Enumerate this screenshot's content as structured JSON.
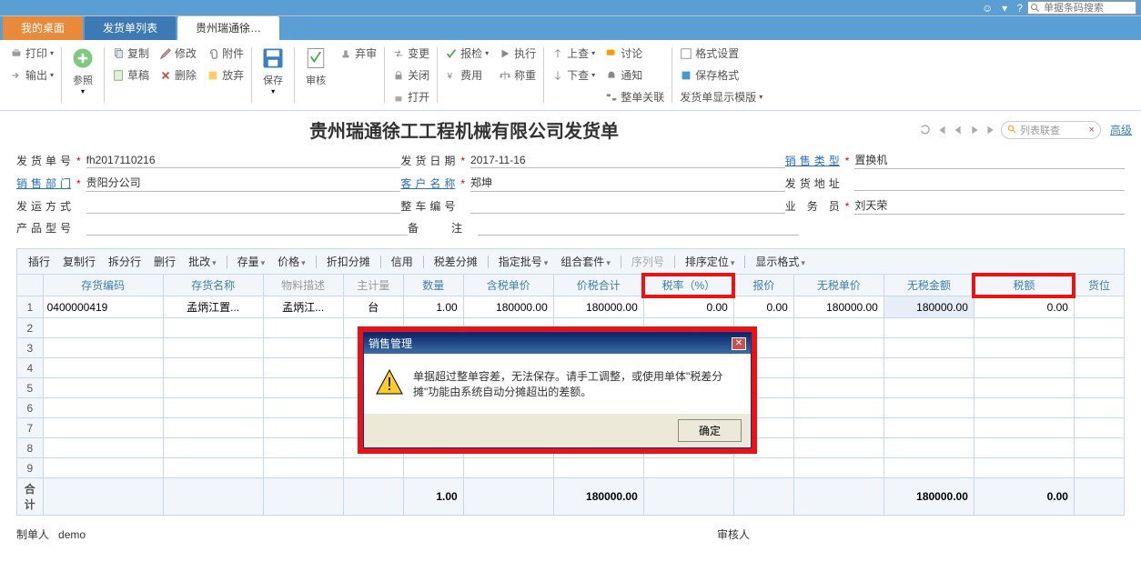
{
  "topbar": {
    "search_placeholder": "单据条码搜索"
  },
  "tabs": [
    {
      "label": "我的桌面",
      "type": "orange"
    },
    {
      "label": "发货单列表",
      "type": "blue"
    },
    {
      "label": "贵州瑞通徐…",
      "type": "active"
    }
  ],
  "toolbar": {
    "print": "打印",
    "output": "输出",
    "ref": "参照",
    "copy": "复制",
    "draft": "草稿",
    "modify": "修改",
    "delete": "删除",
    "attach": "附件",
    "giveup": "放弃",
    "save": "保存",
    "audit": "审核",
    "sendaudit": "弃审",
    "change": "变更",
    "close": "关闭",
    "open": "打开",
    "recheck": "报检",
    "fee": "费用",
    "exec": "执行",
    "weigh": "称重",
    "upcheck": "上查",
    "downcheck": "下查",
    "discuss": "讨论",
    "notify": "通知",
    "wholeclose": "整单关联",
    "fmtset": "格式设置",
    "savefmt": "保存格式",
    "display": "发货单显示模版"
  },
  "title": "贵州瑞通徐工工程机械有限公司发货单",
  "title_nav": {
    "search": "列表联查",
    "advanced": "高级"
  },
  "form": {
    "r1": {
      "l1": "发货单号",
      "v1": "fh2017110216",
      "l2": "发货日期",
      "v2": "2017-11-16",
      "l3": "销售类型",
      "v3": "置换机"
    },
    "r2": {
      "l1": "销售部门",
      "v1": "贵阳分公司",
      "l2": "客户名称",
      "v2": "郑坤",
      "l3": "发货地址",
      "v3": ""
    },
    "r3": {
      "l1": "发运方式",
      "v1": "",
      "l2": "整车编号",
      "v2": "",
      "l3": "业 务 员",
      "v3": "刘天荣"
    },
    "r4": {
      "l1": "产品型号",
      "v1": "",
      "l2": "备注",
      "v2": ""
    }
  },
  "actions": {
    "insert": "插行",
    "copyrow": "复制行",
    "splitrow": "拆分行",
    "delrow": "删行",
    "batchchg": "批改",
    "inventory": "存量",
    "price": "价格",
    "discount": "折扣分摊",
    "credit": "信用",
    "taxsplit": "税差分摊",
    "batch": "指定批号",
    "combo": "组合套件",
    "serial": "序列号",
    "sortloc": "排序定位",
    "dispfmt": "显示格式"
  },
  "headers": {
    "code": "存货编码",
    "name": "存货名称",
    "mat": "物料描述",
    "unit": "主计量",
    "qty": "数量",
    "taxprice": "含税单价",
    "taxtotal": "价税合计",
    "taxrate": "税率（%）",
    "quote": "报价",
    "price": "无税单价",
    "amount": "无税金额",
    "tax": "税额",
    "loc": "货位"
  },
  "rows": [
    {
      "n": "1",
      "code": "0400000419",
      "name": "孟炳江置...",
      "mat": "孟炳江...",
      "unit": "台",
      "qty": "1.00",
      "taxprice": "180000.00",
      "taxtotal": "180000.00",
      "taxrate": "0.00",
      "quote": "0.00",
      "price": "180000.00",
      "amount": "180000.00",
      "tax": "0.00",
      "loc": ""
    }
  ],
  "total": {
    "label": "合计",
    "qty": "1.00",
    "taxtotal": "180000.00",
    "amount": "180000.00",
    "tax": "0.00"
  },
  "footer": {
    "l1": "制单人",
    "v1": "demo",
    "l2": "审核人"
  },
  "dialog": {
    "title": "销售管理",
    "msg": "单据超过整单容差，无法保存。请手工调整，或使用单体\"税差分摊\"功能由系统自动分摊超出的差额。",
    "ok": "确定"
  }
}
